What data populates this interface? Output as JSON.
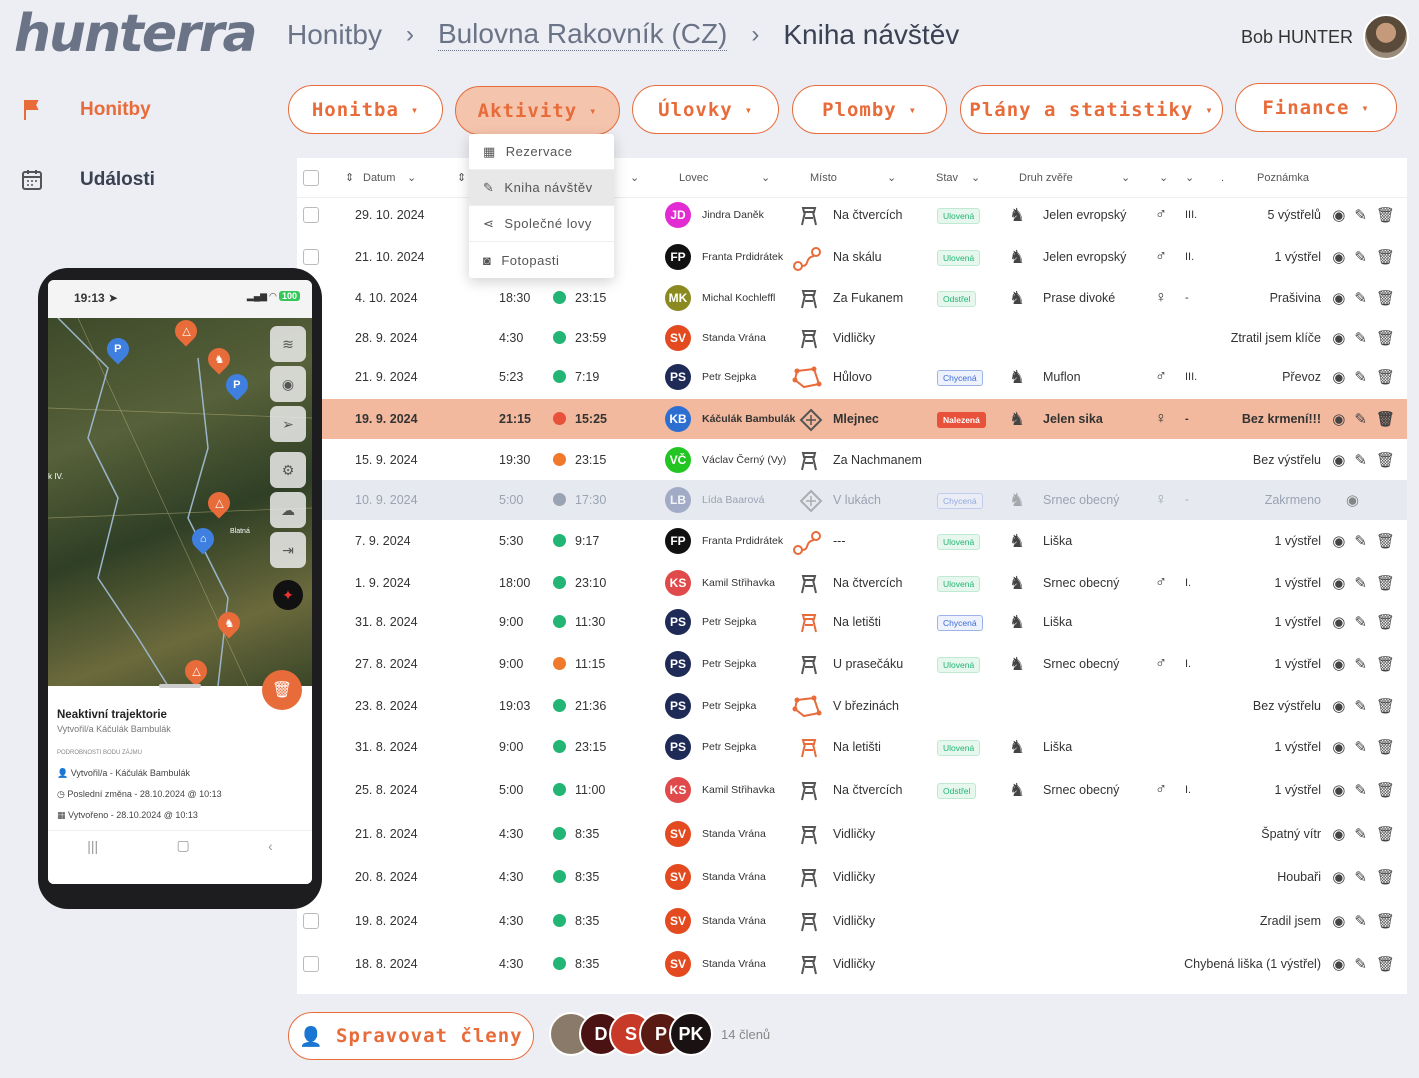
{
  "brand": "hunterra",
  "breadcrumb": {
    "root": "Honitby",
    "parent": "Bulovna Rakovník (CZ)",
    "current": "Kniha návštěv"
  },
  "user": {
    "name": "Bob HUNTER"
  },
  "sidebar": [
    {
      "label": "Honitby",
      "icon": "flag-icon"
    },
    {
      "label": "Události",
      "icon": "calendar-icon"
    }
  ],
  "tabs": [
    {
      "label": "Honitba"
    },
    {
      "label": "Aktivity"
    },
    {
      "label": "Úlovky"
    },
    {
      "label": "Plomby"
    },
    {
      "label": "Plány a statistiky"
    },
    {
      "label": "Finance"
    }
  ],
  "dropdown": [
    {
      "label": "Rezervace",
      "icon": "reservation-icon"
    },
    {
      "label": "Kniha návštěv",
      "icon": "edit-icon"
    },
    {
      "label": "Společné lovy",
      "icon": "share-icon"
    },
    {
      "label": "Fotopasti",
      "icon": "camera-icon"
    }
  ],
  "columns": {
    "date": "Datum",
    "hunter": "Lovec",
    "place": "Místo",
    "state": "Stav",
    "species": "Druh zvěře",
    "dot": ".",
    "note": "Poznámka"
  },
  "rows": [
    {
      "date": "29. 10. 2024",
      "from": "",
      "to": "",
      "ini": "JD",
      "col": "#e22bd2",
      "hunter": "Jindra Daněk",
      "ptype": "tower",
      "place": "Na čtvercích",
      "state": "Ulovená",
      "stype": "u",
      "species": "Jelen evropský",
      "sex": "♂",
      "cls": "III.",
      "note": "5 výstřelů"
    },
    {
      "date": "21. 10. 2024",
      "from": "",
      "to": "",
      "ini": "FP",
      "col": "#111111",
      "hunter": "Franta Prdidrátek",
      "ptype": "route",
      "place": "Na skálu",
      "state": "Ulovená",
      "stype": "u",
      "species": "Jelen evropský",
      "sex": "♂",
      "cls": "II.",
      "note": "1 výstřel"
    },
    {
      "date": "4. 10. 2024",
      "from": "18:30",
      "to": "23:15",
      "ini": "MK",
      "col": "#8a8a20",
      "hunter": "Michal Kochleffl",
      "ptype": "tower",
      "place": "Za Fukanem",
      "state": "Odstřel",
      "stype": "o",
      "species": "Prase divoké",
      "sex": "♀",
      "cls": "-",
      "note": "Prašivina"
    },
    {
      "date": "28. 9. 2024",
      "from": "4:30",
      "to": "23:59",
      "ini": "SV",
      "col": "#e34a1f",
      "hunter": "Standa Vrána",
      "ptype": "tower",
      "place": "Vidličky",
      "state": "",
      "stype": "",
      "species": "",
      "sex": "",
      "cls": "",
      "note": "Ztratil jsem klíče"
    },
    {
      "date": "21. 9. 2024",
      "from": "5:23",
      "to": "7:19",
      "ini": "PS",
      "col": "#1f2b57",
      "hunter": "Petr Sejpka",
      "ptype": "area",
      "place": "Hůlovo",
      "state": "Chycená",
      "stype": "ch",
      "species": "Muflon",
      "sex": "♂",
      "cls": "III.",
      "note": "Převoz"
    },
    {
      "date": "19. 9. 2024",
      "from": "21:15",
      "to": "15:25",
      "ini": "KB",
      "col": "#2d6fd1",
      "hunter": "Káčulák Bambulák",
      "ptype": "feeder",
      "place": "Mlejnec",
      "state": "Nalezená",
      "stype": "n",
      "species": "Jelen sika",
      "sex": "♀",
      "cls": "-",
      "note": "Bez krmení!!!"
    },
    {
      "date": "15. 9. 2024",
      "from": "19:30",
      "to": "23:15",
      "ini": "VČ",
      "col": "#22c522",
      "hunter": "Václav Černý (Vy)",
      "ptype": "tower",
      "place": "Za Nachmanem",
      "state": "",
      "stype": "",
      "species": "",
      "sex": "",
      "cls": "",
      "note": "Bez výstřelu"
    },
    {
      "date": "10. 9. 2024",
      "from": "5:00",
      "to": "17:30",
      "ini": "LB",
      "col": "#6b7aa6",
      "hunter": "Lída Baarová",
      "ptype": "feeder",
      "place": "V lukách",
      "state": "Chycená",
      "stype": "ch",
      "species": "Srnec obecný",
      "sex": "♀",
      "cls": "-",
      "note": "Zakrmeno"
    },
    {
      "date": "7. 9. 2024",
      "from": "5:30",
      "to": "9:17",
      "ini": "FP",
      "col": "#111111",
      "hunter": "Franta Prdidrátek",
      "ptype": "route",
      "place": "---",
      "state": "Ulovená",
      "stype": "u",
      "species": "Liška",
      "sex": "",
      "cls": "",
      "note": "1 výstřel"
    },
    {
      "date": "1. 9. 2024",
      "from": "18:00",
      "to": "23:10",
      "ini": "KS",
      "col": "#e04a4a",
      "hunter": "Kamil Střihavka",
      "ptype": "tower",
      "place": "Na čtvercích",
      "state": "Ulovená",
      "stype": "u",
      "species": "Srnec obecný",
      "sex": "♂",
      "cls": "I.",
      "note": "1 výstřel"
    },
    {
      "date": "31. 8. 2024",
      "from": "9:00",
      "to": "11:30",
      "ini": "PS",
      "col": "#1f2b57",
      "hunter": "Petr Sejpka",
      "ptype": "towero",
      "place": "Na letišti",
      "state": "Chycená",
      "stype": "ch",
      "species": "Liška",
      "sex": "",
      "cls": "",
      "note": "1 výstřel"
    },
    {
      "date": "27. 8. 2024",
      "from": "9:00",
      "to": "11:15",
      "ini": "PS",
      "col": "#1f2b57",
      "hunter": "Petr Sejpka",
      "ptype": "tower",
      "place": "U prasečáku",
      "state": "Ulovená",
      "stype": "u",
      "species": "Srnec obecný",
      "sex": "♂",
      "cls": "I.",
      "note": "1 výstřel"
    },
    {
      "date": "23. 8. 2024",
      "from": "19:03",
      "to": "21:36",
      "ini": "PS",
      "col": "#1f2b57",
      "hunter": "Petr Sejpka",
      "ptype": "area",
      "place": "V březinách",
      "state": "",
      "stype": "",
      "species": "",
      "sex": "",
      "cls": "",
      "note": "Bez výstřelu"
    },
    {
      "date": "31. 8. 2024",
      "from": "9:00",
      "to": "23:15",
      "ini": "PS",
      "col": "#1f2b57",
      "hunter": "Petr Sejpka",
      "ptype": "towero",
      "place": "Na letišti",
      "state": "Ulovená",
      "stype": "u",
      "species": "Liška",
      "sex": "",
      "cls": "",
      "note": "1 výstřel"
    },
    {
      "date": "25. 8. 2024",
      "from": "5:00",
      "to": "11:00",
      "ini": "KS",
      "col": "#e04a4a",
      "hunter": "Kamil Střihavka",
      "ptype": "tower",
      "place": "Na čtvercích",
      "state": "Odstřel",
      "stype": "o",
      "species": "Srnec obecný",
      "sex": "♂",
      "cls": "I.",
      "note": "1 výstřel"
    },
    {
      "date": "21. 8. 2024",
      "from": "4:30",
      "to": "8:35",
      "ini": "SV",
      "col": "#e34a1f",
      "hunter": "Standa Vrána",
      "ptype": "tower",
      "place": "Vidličky",
      "state": "",
      "stype": "",
      "species": "",
      "sex": "",
      "cls": "",
      "note": "Špatný vítr"
    },
    {
      "date": "20. 8. 2024",
      "from": "4:30",
      "to": "8:35",
      "ini": "SV",
      "col": "#e34a1f",
      "hunter": "Standa Vrána",
      "ptype": "tower",
      "place": "Vidličky",
      "state": "",
      "stype": "",
      "species": "",
      "sex": "",
      "cls": "",
      "note": "Houbaři"
    },
    {
      "date": "19. 8. 2024",
      "from": "4:30",
      "to": "8:35",
      "ini": "SV",
      "col": "#e34a1f",
      "hunter": "Standa Vrána",
      "ptype": "tower",
      "place": "Vidličky",
      "state": "",
      "stype": "",
      "species": "",
      "sex": "",
      "cls": "",
      "note": "Zradil jsem"
    },
    {
      "date": "18. 8. 2024",
      "from": "4:30",
      "to": "8:35",
      "ini": "SV",
      "col": "#e34a1f",
      "hunter": "Standa Vrána",
      "ptype": "tower",
      "place": "Vidličky",
      "state": "",
      "stype": "",
      "species": "",
      "sex": "",
      "cls": "",
      "note": "Chybená liška (1 výstřel)"
    }
  ],
  "phone": {
    "time": "19:13",
    "battery": "100",
    "map_label_blatna": "Blatná",
    "map_label_left": "k IV.",
    "sheet_title": "Neaktivní trajektorie",
    "sheet_subtitle": "Vytvořil/a Káčulák Bambulák",
    "section": "PODROBNOSTI BODU ZÁJMU",
    "line1": "Vytvořil/a - Káčulák Bambulák",
    "line2": "Poslední změna - 28.10.2024 @ 10:13",
    "line3": "Vytvořeno - 28.10.2024 @ 10:13"
  },
  "footer": {
    "manage_label": "Spravovat členy",
    "members_count": "14 členů",
    "members": [
      "D",
      "S",
      "P",
      "PK"
    ]
  }
}
